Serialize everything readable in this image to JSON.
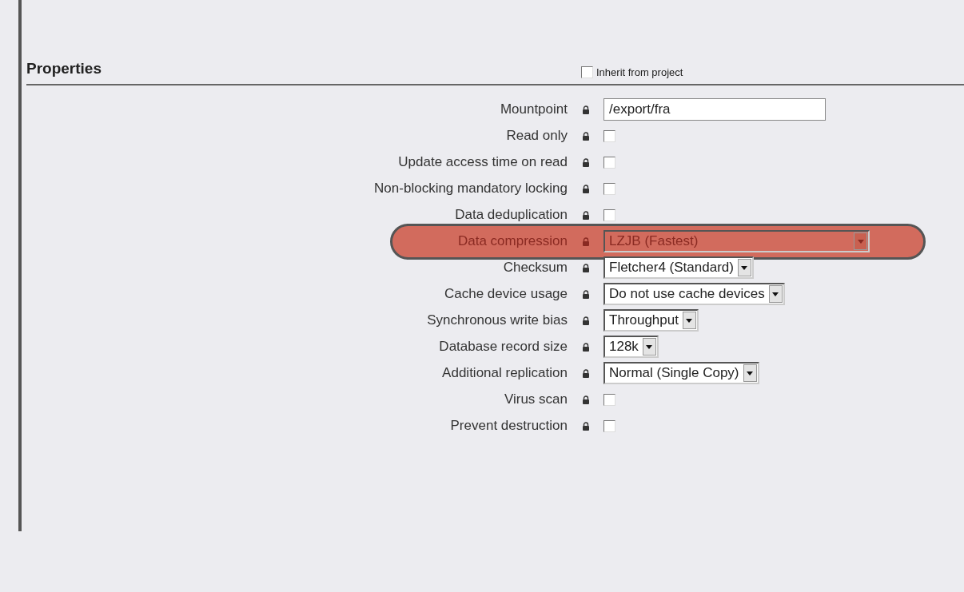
{
  "section": {
    "title": "Properties",
    "inherit": {
      "label": "Inherit from project",
      "checked": false
    }
  },
  "rows": [
    {
      "label": "Mountpoint",
      "kind": "text",
      "value": "/export/fra",
      "highlighted": false
    },
    {
      "label": "Read only",
      "kind": "checkbox",
      "checked": false,
      "highlighted": false
    },
    {
      "label": "Update access time on read",
      "kind": "checkbox",
      "checked": false,
      "highlighted": false
    },
    {
      "label": "Non-blocking mandatory locking",
      "kind": "checkbox",
      "checked": false,
      "highlighted": false
    },
    {
      "label": "Data deduplication",
      "kind": "checkbox",
      "checked": false,
      "highlighted": false
    },
    {
      "label": "Data compression",
      "kind": "select",
      "value": "LZJB (Fastest)",
      "highlighted": true
    },
    {
      "label": "Checksum",
      "kind": "select",
      "value": "Fletcher4 (Standard)",
      "highlighted": false
    },
    {
      "label": "Cache device usage",
      "kind": "select",
      "value": "Do not use cache devices",
      "highlighted": false
    },
    {
      "label": "Synchronous write bias",
      "kind": "select",
      "value": "Throughput",
      "highlighted": false
    },
    {
      "label": "Database record size",
      "kind": "select",
      "value": "128k",
      "highlighted": false
    },
    {
      "label": "Additional replication",
      "kind": "select",
      "value": "Normal (Single Copy)",
      "highlighted": false
    },
    {
      "label": "Virus scan",
      "kind": "checkbox",
      "checked": false,
      "highlighted": false
    },
    {
      "label": "Prevent destruction",
      "kind": "checkbox",
      "checked": false,
      "highlighted": false
    }
  ]
}
